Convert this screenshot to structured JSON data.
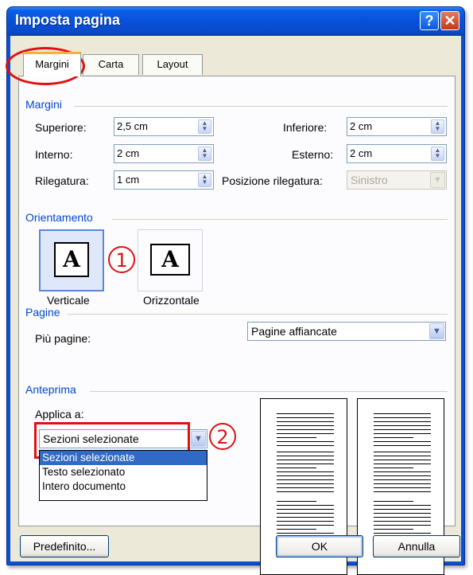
{
  "window": {
    "title": "Imposta pagina",
    "help_glyph": "?",
    "close_glyph": "✕"
  },
  "tabs": [
    {
      "label": "Margini",
      "active": true
    },
    {
      "label": "Carta",
      "active": false
    },
    {
      "label": "Layout",
      "active": false
    }
  ],
  "margins": {
    "group_title": "Margini",
    "top_label": "Superiore:",
    "top_value": "2,5 cm",
    "bottom_label": "Inferiore:",
    "bottom_value": "2 cm",
    "inner_label": "Interno:",
    "inner_value": "2 cm",
    "outer_label": "Esterno:",
    "outer_value": "2 cm",
    "gutter_label": "Rilegatura:",
    "gutter_value": "1 cm",
    "gutter_pos_label": "Posizione rilegatura:",
    "gutter_pos_value": "Sinistro"
  },
  "orientation": {
    "group_title": "Orientamento",
    "portrait_label": "Verticale",
    "landscape_label": "Orizzontale",
    "page_glyph": "A",
    "selected": "Verticale"
  },
  "pages": {
    "group_title": "Pagine",
    "multiple_label": "Più pagine:",
    "multiple_value": "Pagine affiancate"
  },
  "preview": {
    "group_title": "Anteprima",
    "apply_label": "Applica a:",
    "apply_value": "Sezioni selezionate",
    "options": [
      "Sezioni selezionate",
      "Testo selezionato",
      "Intero documento"
    ]
  },
  "buttons": {
    "default_label": "Predefinito...",
    "ok_label": "OK",
    "cancel_label": "Annulla"
  },
  "annotations": {
    "marker_1": "1",
    "marker_2": "2",
    "color": "#e01010"
  },
  "colors": {
    "title_bar": "#0a50d6",
    "group_title": "#0046d5",
    "tab_highlight": "#f5b03e",
    "selection": "#316ac5"
  }
}
